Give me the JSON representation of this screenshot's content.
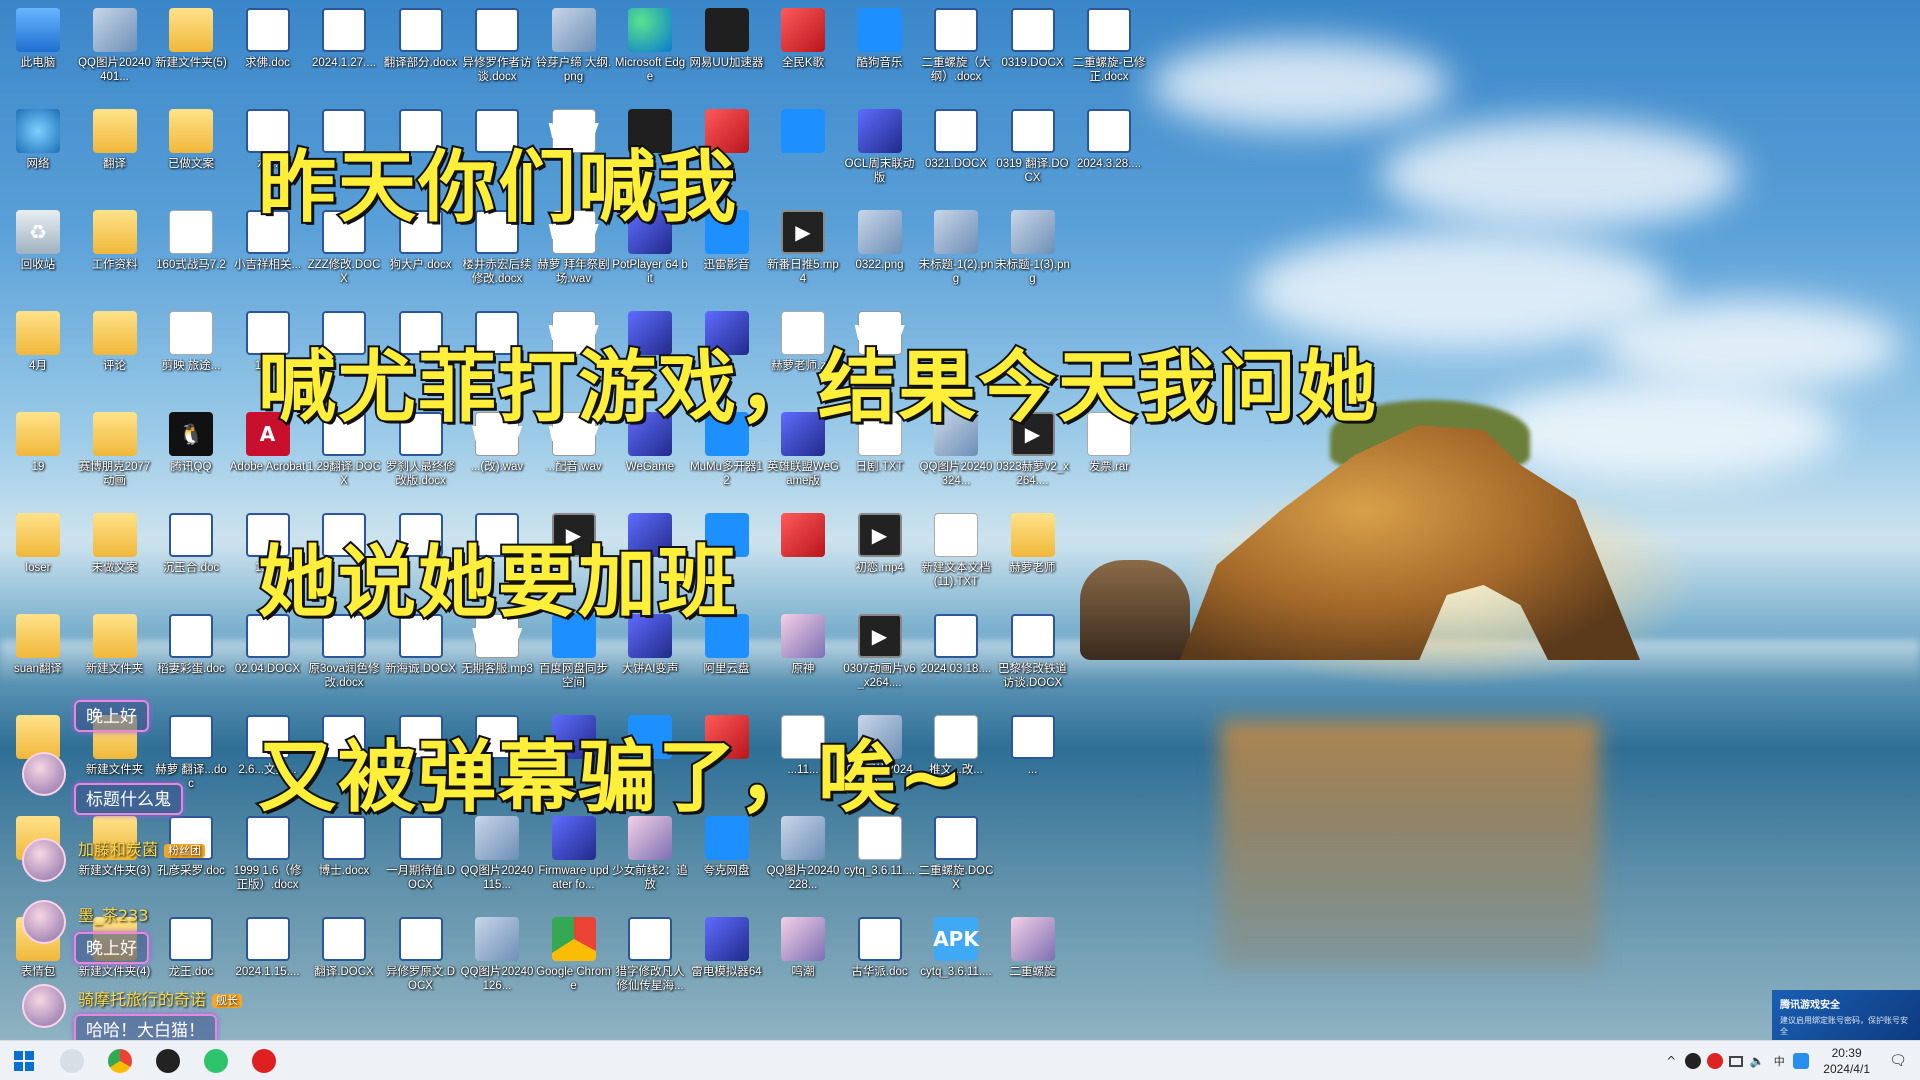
{
  "desktop": {
    "icons": [
      [
        "此电脑",
        "pc",
        "pc-icon"
      ],
      [
        "QQ图片20240401...",
        "img",
        "image-file-icon"
      ],
      [
        "新建文件夹(5)",
        "folder",
        "folder-icon"
      ],
      [
        "求佛.doc",
        "word",
        "word-doc-icon"
      ],
      [
        "2024.1.27....",
        "word",
        "word-doc-icon"
      ],
      [
        "翻译部分.docx",
        "word",
        "word-doc-icon"
      ],
      [
        "异修罗作者访谈.docx",
        "word",
        "word-doc-icon"
      ],
      [
        "铃芽户缔 大纲.png",
        "img",
        "image-file-icon"
      ],
      [
        "Microsoft Edge",
        "edge",
        "edge-icon"
      ],
      [
        "网易UU加速器",
        "dark",
        "uu-accelerator-icon"
      ],
      [
        "全民K歌",
        "red",
        "kge-icon"
      ],
      [
        "酷狗音乐",
        "blue",
        "kugou-icon"
      ],
      [
        "二重螺旋（大纲）.docx",
        "word",
        "word-doc-icon"
      ],
      [
        "0319.DOCX",
        "word",
        "word-doc-icon"
      ],
      [
        "二重螺旋-已修正.docx",
        "word",
        "word-doc-icon"
      ],
      [
        "网络",
        "net",
        "network-icon"
      ],
      [
        "翻译",
        "folder",
        "folder-icon"
      ],
      [
        "已做文案",
        "folder",
        "folder-icon"
      ],
      [
        "水...",
        "word",
        "word-doc-icon"
      ],
      [
        "",
        "word",
        "word-doc-icon"
      ],
      [
        "",
        "word",
        "word-doc-icon"
      ],
      [
        "",
        "word",
        "word-doc-icon"
      ],
      [
        "",
        "wav",
        "wav-file-icon"
      ],
      [
        "",
        "dark",
        "obs-icon"
      ],
      [
        "",
        "red",
        "netease-music-icon"
      ],
      [
        "",
        "blue",
        "feishu-icon"
      ],
      [
        "OCL周末联动版",
        "app",
        "ocl-app-icon"
      ],
      [
        "0321.DOCX",
        "word",
        "word-doc-icon"
      ],
      [
        "0319 翻译.DOCX",
        "word",
        "word-doc-icon"
      ],
      [
        "2024.3.28....",
        "word",
        "word-doc-icon"
      ],
      [
        "回收站",
        "bin",
        "recycle-bin-icon"
      ],
      [
        "工作资料",
        "folder",
        "folder-icon"
      ],
      [
        "160式战马7.2",
        "txt",
        "file-icon"
      ],
      [
        "小吉祥相关...",
        "word",
        "word-doc-icon"
      ],
      [
        "ZZZ修改.DOCX",
        "word",
        "word-doc-icon"
      ],
      [
        "狗大户.docx",
        "word",
        "word-doc-icon"
      ],
      [
        "楼井赤宏后续修改.docx",
        "word",
        "word-doc-icon"
      ],
      [
        "赫萝 拜年祭剧场.wav",
        "wav",
        "wav-file-icon"
      ],
      [
        "PotPlayer 64 bit",
        "app",
        "potplayer-icon"
      ],
      [
        "迅雷影音",
        "blue",
        "xunlei-icon"
      ],
      [
        "新番日推5.mp4",
        "vid",
        "video-file-icon"
      ],
      [
        "0322.png",
        "img",
        "image-file-icon"
      ],
      [
        "未标题-1(2).png",
        "img",
        "image-file-icon"
      ],
      [
        "未标题-1(3).png",
        "img",
        "image-file-icon"
      ],
      [
        "4月",
        "folder",
        "folder-icon"
      ],
      [
        "评论",
        "folder",
        "folder-icon"
      ],
      [
        "剪映 旅途...",
        "txt",
        "file-icon"
      ],
      [
        "1.2...",
        "word",
        "word-doc-icon"
      ],
      [
        "",
        "word",
        "word-doc-icon"
      ],
      [
        "",
        "word",
        "word-doc-icon"
      ],
      [
        "",
        "word",
        "word-doc-icon"
      ],
      [
        "",
        "wav",
        "wav-file-icon"
      ],
      [
        "",
        "app",
        "app-icon"
      ],
      [
        "",
        "app",
        "app-icon"
      ],
      [
        "赫萝老师.zip",
        "txt",
        "zip-file-icon"
      ],
      [
        "赫...",
        "wav",
        "wav-file-icon"
      ],
      [
        "19",
        "folder",
        "folder-icon"
      ],
      [
        "赛博朋克2077动画",
        "folder",
        "folder-icon"
      ],
      [
        "腾讯QQ",
        "qq",
        "qq-icon"
      ],
      [
        "Adobe Acrobat",
        "pdf",
        "acrobat-icon"
      ],
      [
        "1.29翻译.DOCX",
        "word",
        "word-doc-icon"
      ],
      [
        "罗刹人最终修改版.docx",
        "word",
        "word-doc-icon"
      ],
      [
        "...(改).wav",
        "wav",
        "wav-file-icon"
      ],
      [
        "...配音.wav",
        "wav",
        "wav-file-icon"
      ],
      [
        "WeGame",
        "app",
        "wegame-icon"
      ],
      [
        "MuMu多开器12",
        "blue",
        "mumu-icon"
      ],
      [
        "英雄联盟WeGame版",
        "app",
        "lol-icon"
      ],
      [
        "日剧.TXT",
        "txt",
        "txt-file-icon"
      ],
      [
        "QQ图片20240324...",
        "img",
        "image-file-icon"
      ],
      [
        "0323赫萝v2_x264....",
        "vid",
        "video-file-icon"
      ],
      [
        "发票.rar",
        "txt",
        "rar-file-icon"
      ],
      [
        "loser",
        "folder",
        "folder-icon"
      ],
      [
        "未做文案",
        "folder",
        "folder-icon"
      ],
      [
        "沉玉合.doc",
        "word",
        "word-doc-icon"
      ],
      [
        "1.2...",
        "word",
        "word-doc-icon"
      ],
      [
        "",
        "word",
        "word-doc-icon"
      ],
      [
        "",
        "word",
        "word-doc-icon"
      ],
      [
        "",
        "word",
        "word-doc-icon"
      ],
      [
        "",
        "vid",
        "video-file-icon"
      ],
      [
        "",
        "app",
        "app-icon"
      ],
      [
        "",
        "blue",
        "app-icon"
      ],
      [
        "",
        "red",
        "app-icon"
      ],
      [
        "初恋.mp4",
        "vid",
        "video-file-icon"
      ],
      [
        "新建文本文档(11).TXT",
        "txt",
        "txt-file-icon"
      ],
      [
        "赫萝老师",
        "folder",
        "folder-icon"
      ],
      [
        "suan翻译",
        "folder",
        "folder-icon"
      ],
      [
        "新建文件夹",
        "folder",
        "folder-icon"
      ],
      [
        "稻妻彩蛋.doc",
        "word",
        "word-doc-icon"
      ],
      [
        "02.04.DOCX",
        "word",
        "word-doc-icon"
      ],
      [
        "原3ova润色修改.docx",
        "word",
        "word-doc-icon"
      ],
      [
        "新海诚.DOCX",
        "word",
        "word-doc-icon"
      ],
      [
        "无期客服.mp3",
        "wav",
        "mp3-file-icon"
      ],
      [
        "百度网盘同步空间",
        "blue",
        "baidu-sync-icon"
      ],
      [
        "大饼AI变声",
        "app",
        "voice-changer-icon"
      ],
      [
        "阿里云盘",
        "blue",
        "aliyun-drive-icon"
      ],
      [
        "原神",
        "char",
        "genshin-icon"
      ],
      [
        "0307动画片v6_x264....",
        "vid",
        "video-file-icon"
      ],
      [
        "2024.03.18....",
        "word",
        "word-doc-icon"
      ],
      [
        "巴黎修改铁道访谈.DOCX",
        "word",
        "word-doc-icon"
      ],
      [
        "V...",
        "folder",
        "folder-icon"
      ],
      [
        "新建文件夹",
        "folder",
        "folder-icon"
      ],
      [
        "赫萝 翻译...doc",
        "word",
        "word-doc-icon"
      ],
      [
        "2.6...文案...",
        "word",
        "word-doc-icon"
      ],
      [
        "",
        "word",
        "word-doc-icon"
      ],
      [
        "",
        "word",
        "word-doc-icon"
      ],
      [
        "",
        "word",
        "word-doc-icon"
      ],
      [
        "",
        "app",
        "app-icon"
      ],
      [
        "",
        "blue",
        "app-icon"
      ],
      [
        "",
        "red",
        "app-icon"
      ],
      [
        "...11...",
        "txt",
        "file-icon"
      ],
      [
        "QQ图片20240...",
        "img",
        "image-file-icon"
      ],
      [
        "推文...改...",
        "txt",
        "file-icon"
      ],
      [
        "...",
        "word",
        "word-doc-icon"
      ],
      [
        "",
        "folder",
        "folder-icon"
      ],
      [
        "新建文件夹(3)",
        "folder",
        "folder-icon"
      ],
      [
        "孔彦采罗.doc",
        "word",
        "word-doc-icon"
      ],
      [
        "1999 1.6（修正版）.docx",
        "word",
        "word-doc-icon"
      ],
      [
        "博士.docx",
        "word",
        "word-doc-icon"
      ],
      [
        "一月期待值.DOCX",
        "word",
        "word-doc-icon"
      ],
      [
        "QQ图片20240115...",
        "img",
        "image-file-icon"
      ],
      [
        "Firmware updater fo...",
        "app",
        "firmware-updater-icon"
      ],
      [
        "少女前线2：追放",
        "char",
        "girls-frontline-icon"
      ],
      [
        "夸克网盘",
        "blue",
        "quark-drive-icon"
      ],
      [
        "QQ图片20240228...",
        "img",
        "image-file-icon"
      ],
      [
        "cytq_3.6.11....",
        "txt",
        "file-icon"
      ],
      [
        "二重螺旋.DOCX",
        "word",
        "word-doc-icon"
      ],
      [
        "表情包",
        "folder",
        "folder-icon"
      ],
      [
        "新建文件夹(4)",
        "folder",
        "folder-icon"
      ],
      [
        "龙王.doc",
        "word",
        "word-doc-icon"
      ],
      [
        "2024.1.15....",
        "word",
        "word-doc-icon"
      ],
      [
        "翻译.DOCX",
        "word",
        "word-doc-icon"
      ],
      [
        "异修罗原文.DOCX",
        "word",
        "word-doc-icon"
      ],
      [
        "QQ图片20240126...",
        "img",
        "image-file-icon"
      ],
      [
        "Google Chrome",
        "chrome",
        "chrome-icon"
      ],
      [
        "猎字修改凡人修仙传星海...",
        "word",
        "word-doc-icon"
      ],
      [
        "雷电模拟器64",
        "app",
        "ldplayer-icon"
      ],
      [
        "鸣潮",
        "char",
        "wuthering-waves-icon"
      ],
      [
        "古华派.doc",
        "word",
        "word-doc-icon"
      ],
      [
        "cytq_3.6.11....",
        "apk",
        "apk-file-icon"
      ],
      [
        "二重螺旋",
        "char",
        "app-icon"
      ]
    ]
  },
  "captions": {
    "line1": "昨天你们喊我",
    "line2": "喊尤菲打游戏，结果今天我问她",
    "line3": "她说她要加班",
    "line4": "又被弹幕骗了，唉~"
  },
  "chat": {
    "bubble1": "晚上好",
    "bubble2": "标题什么鬼",
    "name1": "加藤和炭菌",
    "badge1": "粉丝团",
    "name2": "墨_茶233",
    "bubble3": "晚上好",
    "name3": "骑摩托旅行的奇诺",
    "badge3": "舰长",
    "bubble4": "哈哈！大白猫！"
  },
  "notification": {
    "title": "腾讯游戏安全",
    "body": "建议启用绑定账号密码，保护账号安全"
  },
  "taskbar": {
    "tray_caret": "^",
    "clock_time": "20:39",
    "clock_date": "2024/4/1"
  },
  "colors": {
    "caption_fill": "#ffef3a",
    "caption_stroke": "#111111",
    "taskbar_bg": "#eef2f6"
  }
}
